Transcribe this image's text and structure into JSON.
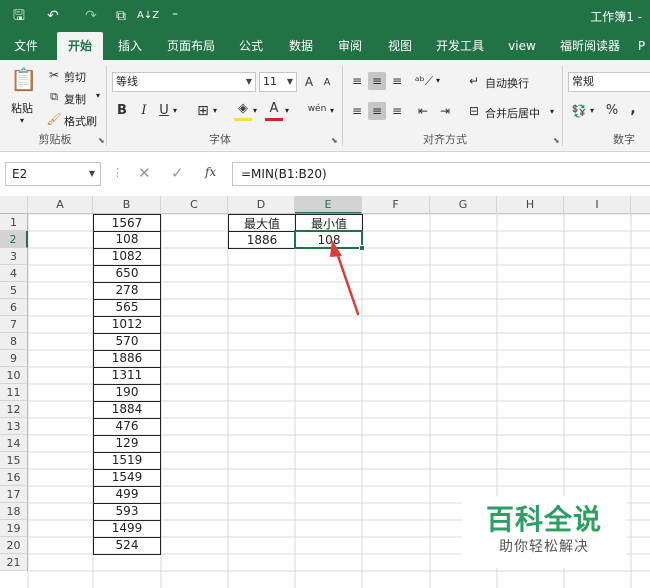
{
  "window": {
    "title": "工作簿1 -"
  },
  "qat": {
    "save": "🖫",
    "undo": "↶",
    "redo": "↷",
    "preview": "⧉",
    "sort": "A↓Z",
    "more": "⁼"
  },
  "tabs": [
    {
      "label": "文件"
    },
    {
      "label": "开始"
    },
    {
      "label": "插入"
    },
    {
      "label": "页面布局"
    },
    {
      "label": "公式"
    },
    {
      "label": "数据"
    },
    {
      "label": "审阅"
    },
    {
      "label": "视图"
    },
    {
      "label": "开发工具"
    },
    {
      "label": "view"
    },
    {
      "label": "福昕阅读器"
    },
    {
      "label": "P"
    }
  ],
  "ribbon": {
    "clipboard": {
      "paste": "粘贴",
      "cut": "剪切",
      "copy": "复制",
      "painter": "格式刷",
      "label": "剪贴板"
    },
    "font": {
      "name": "等线",
      "size": "11",
      "bold": "B",
      "italic": "I",
      "underline": "U",
      "grow": "A",
      "shrink": "A",
      "phonetic": "wén",
      "label": "字体"
    },
    "align": {
      "wrap": "自动换行",
      "merge": "合并后居中",
      "label": "对齐方式"
    },
    "number": {
      "format": "常规",
      "percent": "%",
      "comma": ",",
      "label": "数字"
    }
  },
  "formula_bar": {
    "name_box": "E2",
    "fx": "fx",
    "formula": "=MIN(B1:B20)"
  },
  "grid": {
    "columns": [
      "A",
      "B",
      "C",
      "D",
      "E",
      "F",
      "G",
      "H",
      "I"
    ],
    "rows": [
      "1",
      "2",
      "3",
      "4",
      "5",
      "6",
      "7",
      "8",
      "9",
      "10",
      "11",
      "12",
      "13",
      "14",
      "15",
      "16",
      "17",
      "18",
      "19",
      "20",
      "21"
    ],
    "b_values": [
      "1567",
      "108",
      "1082",
      "650",
      "278",
      "565",
      "1012",
      "570",
      "1886",
      "1311",
      "190",
      "1884",
      "476",
      "129",
      "1519",
      "1549",
      "499",
      "593",
      "1499",
      "524"
    ],
    "d1": "最大值",
    "e1": "最小值",
    "d2": "1886",
    "e2": "108",
    "active_cell": "E2"
  },
  "colors": {
    "excel_green": "#217346",
    "arrow_red": "#e03a3a",
    "watermark_green": "#2aa163"
  },
  "watermark": {
    "title": "百科全说",
    "subtitle": "助你轻松解决"
  }
}
